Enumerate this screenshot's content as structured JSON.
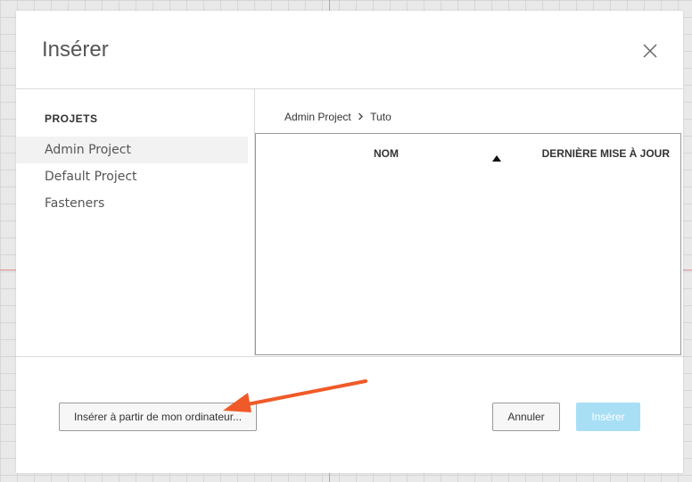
{
  "dialog": {
    "title": "Insérer",
    "close_icon": "close-icon"
  },
  "sidebar": {
    "heading": "PROJETS",
    "items": [
      {
        "label": "Admin Project",
        "selected": true
      },
      {
        "label": "Default Project",
        "selected": false
      },
      {
        "label": "Fasteners",
        "selected": false
      }
    ]
  },
  "breadcrumb": {
    "items": [
      "Admin Project",
      "Tuto"
    ],
    "separator_icon": "chevron-right-icon"
  },
  "table": {
    "columns": [
      "NOM",
      "DERNIÈRE MISE À JOUR"
    ],
    "sort_icon": "sort-ascending-icon",
    "rows": []
  },
  "footer": {
    "upload_label": "Insérer à partir de mon ordinateur...",
    "cancel_label": "Annuler",
    "insert_label": "Insérer"
  },
  "annotation": {
    "arrow_icon": "annotation-arrow-icon",
    "color": "#f05a28"
  }
}
